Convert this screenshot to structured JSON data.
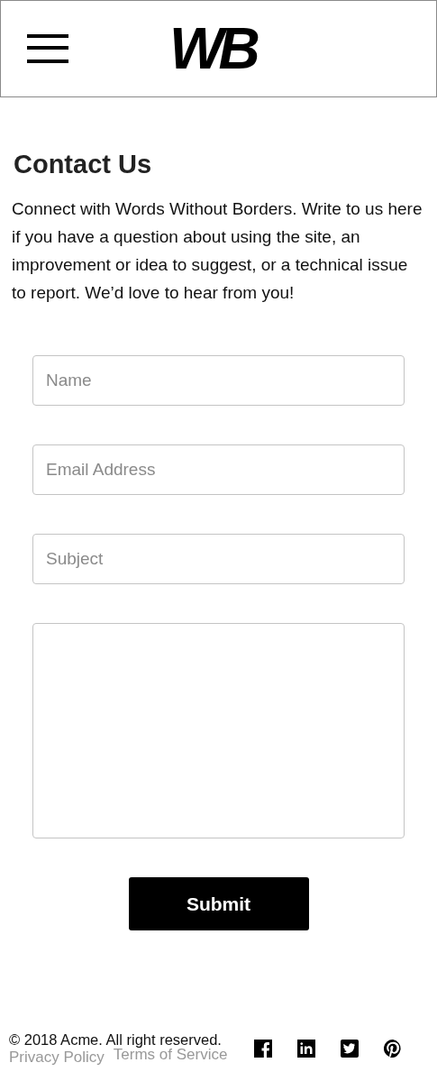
{
  "header": {
    "logo": "WB"
  },
  "title": "Contact Us",
  "intro": "Connect with Words Without Borders. Write to us here if you have a question about using the site, an improvement or idea to suggest, or a technical issue to report. We’d love to hear from you!",
  "form": {
    "fields": [
      {
        "kind": "input",
        "placeholder": "Name"
      },
      {
        "kind": "input",
        "placeholder": "Email Address"
      },
      {
        "kind": "input",
        "placeholder": "Subject"
      },
      {
        "kind": "textarea"
      }
    ],
    "submit": "Submit"
  },
  "footer": {
    "copyright": "© 2018 Acme. All right reserved.",
    "links": [
      "Privacy Policy",
      "Terms of Service"
    ],
    "social": [
      {
        "kind": "facebook"
      },
      {
        "kind": "linkedin"
      },
      {
        "kind": "twitter"
      },
      {
        "kind": "pinterest"
      }
    ]
  }
}
